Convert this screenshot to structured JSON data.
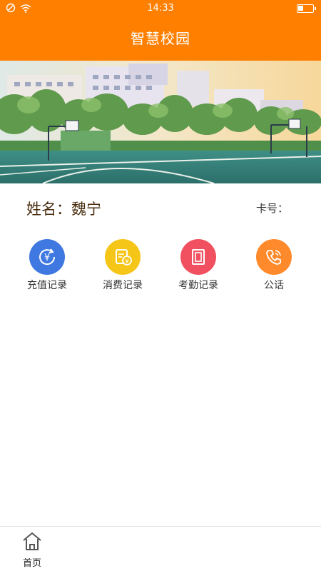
{
  "status_bar": {
    "time": "14:33",
    "battery_level": 0.35
  },
  "app": {
    "title": "智慧校园"
  },
  "profile": {
    "name_label": "姓名：魏宁",
    "card_label": "卡号："
  },
  "actions": [
    {
      "label": "充值记录",
      "icon": "recharge-icon",
      "color": "#3f78e0"
    },
    {
      "label": "消费记录",
      "icon": "receipt-icon",
      "color": "#f5c518"
    },
    {
      "label": "考勤记录",
      "icon": "attendance-icon",
      "color": "#f0505f"
    },
    {
      "label": "公话",
      "icon": "phone-icon",
      "color": "#ff8a2b"
    }
  ],
  "tabbar": {
    "home_label": "首页"
  },
  "colors": {
    "accent": "#ff7f00"
  }
}
